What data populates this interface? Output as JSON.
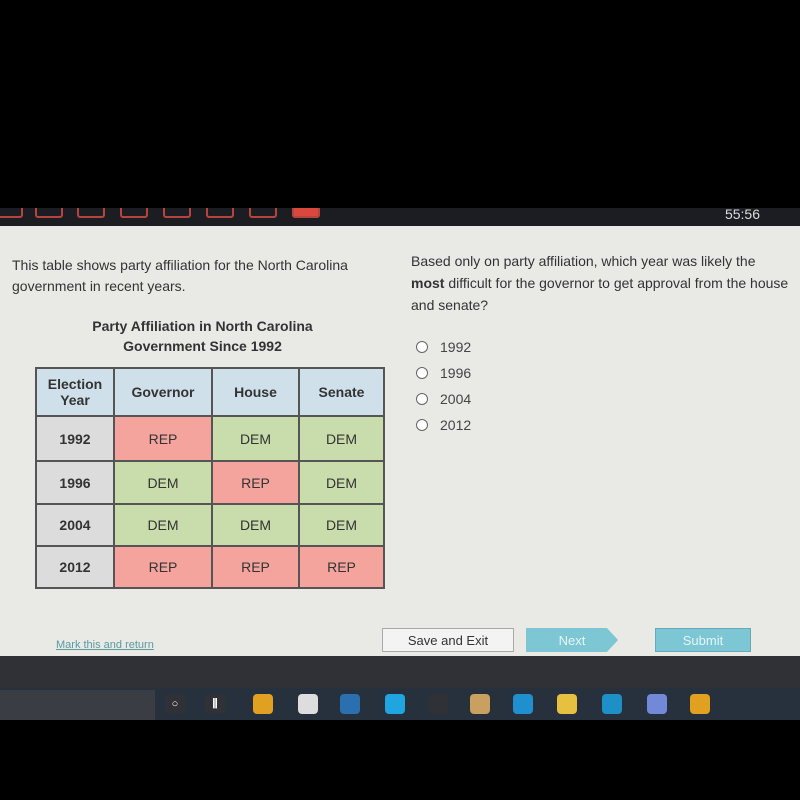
{
  "header": {
    "timer": "55:56"
  },
  "left": {
    "intro": "This table shows party affiliation for the North Carolina government in recent years.",
    "table_title_line1": "Party Affiliation in North Carolina",
    "table_title_line2": "Government Since 1992",
    "columns": [
      "Election Year",
      "Governor",
      "House",
      "Senate"
    ],
    "rows": [
      {
        "year": "1992",
        "governor": "REP",
        "house": "DEM",
        "senate": "DEM"
      },
      {
        "year": "1996",
        "governor": "DEM",
        "house": "REP",
        "senate": "DEM"
      },
      {
        "year": "2004",
        "governor": "DEM",
        "house": "DEM",
        "senate": "DEM"
      },
      {
        "year": "2012",
        "governor": "REP",
        "house": "REP",
        "senate": "REP"
      }
    ]
  },
  "question": {
    "pre": "Based only on party affiliation, which year was likely the ",
    "bold": "most",
    "post": " difficult for the governor to get approval from the house and senate?",
    "options": [
      "1992",
      "1996",
      "2004",
      "2012"
    ]
  },
  "footer": {
    "mark": "Mark this and return",
    "save": "Save and Exit",
    "next": "Next",
    "submit": "Submit"
  },
  "colors": {
    "rep": "#f4a49c",
    "dem": "#c9dcab",
    "header": "#cfe0ea",
    "button": "#7cc7d3"
  },
  "taskbar": {
    "icons": [
      "cortana-icon",
      "task-view-icon",
      "chrome-icon",
      "roblox-icon",
      "steam-icon",
      "skype-icon",
      "app-icon",
      "store-icon",
      "mail-icon",
      "file-explorer-icon",
      "edge-icon",
      "discord-icon",
      "chrome-icon"
    ]
  }
}
